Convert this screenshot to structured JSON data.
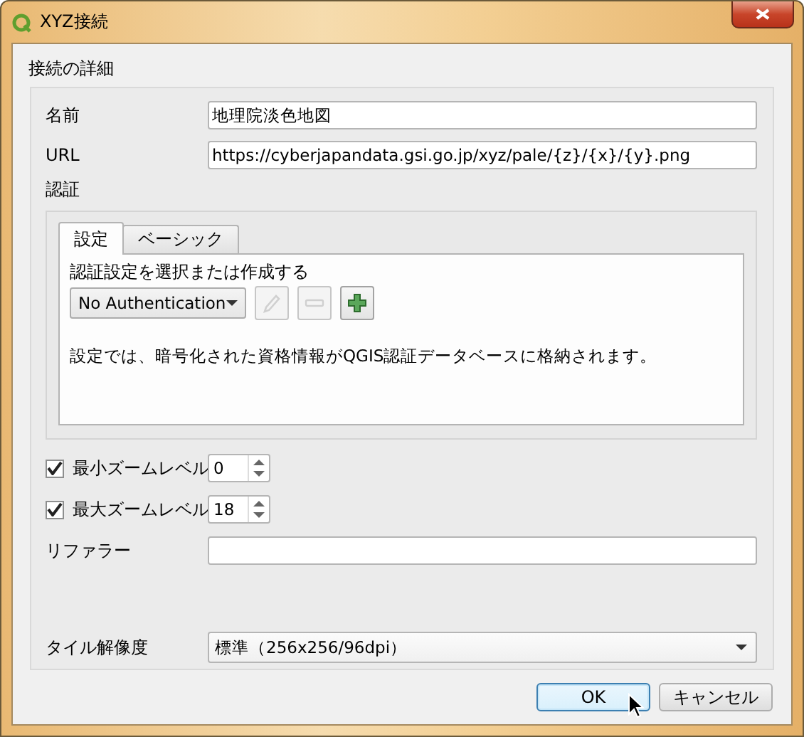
{
  "window": {
    "title": "XYZ接続"
  },
  "section_title": "接続の詳細",
  "fields": [
    {
      "label": "名前",
      "value": "地理院淡色地図"
    },
    {
      "label": "URL",
      "value": "https://cyberjapandata.gsi.go.jp/xyz/pale/{z}/{x}/{y}.png"
    }
  ],
  "auth": {
    "label": "認証",
    "tabs": [
      {
        "label": "設定",
        "selected": true
      },
      {
        "label": "ベーシック",
        "selected": false
      }
    ],
    "prompt": "認証設定を選択または作成する",
    "method": "No Authentication",
    "tools": [
      {
        "kind": "edit",
        "disabled": true
      },
      {
        "kind": "remove",
        "disabled": true
      },
      {
        "kind": "add",
        "disabled": false
      }
    ],
    "note": "設定では、暗号化された資格情報がQGIS認証データベースに格納されます。"
  },
  "zoom_levels": [
    {
      "label": "最小ズームレベル",
      "checked": true,
      "value": "0"
    },
    {
      "label": "最大ズームレベル",
      "checked": true,
      "value": "18"
    }
  ],
  "referer": {
    "label": "リファラー"
  },
  "tile_resolution": {
    "label": "タイル解像度",
    "value": "標準（256x256/96dpi）"
  },
  "buttons": [
    {
      "label": "OK",
      "default": true
    },
    {
      "label": "キャンセル",
      "default": false
    }
  ]
}
